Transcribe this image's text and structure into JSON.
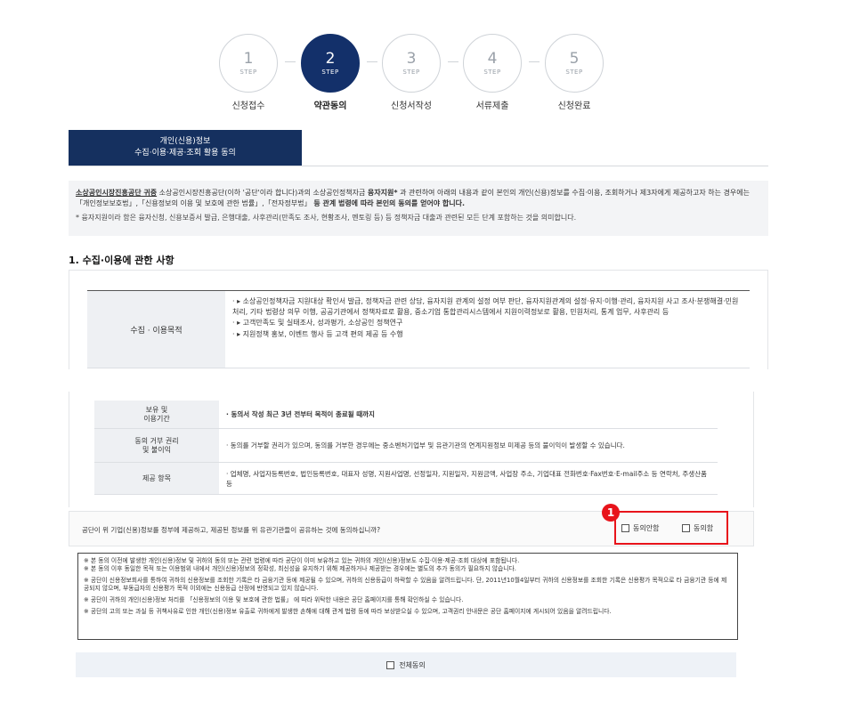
{
  "steps": [
    {
      "num": "1",
      "label": "STEP",
      "name": "신청접수"
    },
    {
      "num": "2",
      "label": "STEP",
      "name": "약관동의"
    },
    {
      "num": "3",
      "label": "STEP",
      "name": "신청서작성"
    },
    {
      "num": "4",
      "label": "STEP",
      "name": "서류제출"
    },
    {
      "num": "5",
      "label": "STEP",
      "name": "신청완료"
    }
  ],
  "tab": {
    "line1": "개인(신용)정보",
    "line2": "수집·이용·제공·조회 활용 동의"
  },
  "intro": {
    "org": "소상공인시장진흥공단 귀중",
    "text1": " 소상공인시장진흥공단(이하 '공단'이라 합니다)과의 소상공인정책자금 ",
    "keyword": "융자지원*",
    "text2": " 과 관련하여 아래의 내용과 같이 본인의 개인(신용)정보를 수집·이용, 조회하거나 제3자에게 제공하고자 하는 경우에는「개인정보보호법」,「신용정보의 이용 및 보호에 관한 법률」,「전자정부법」",
    "bold_end": " 등 관계 법령에 따라 본인의 동의를 얻어야 합니다.",
    "note": "* 융자지원이라 함은 융자신청, 신용보증서 발급, 은행대출, 사후관리(만족도 조사, 현황조사, 멘토링 등) 등 정책자금 대출과 관련된 모든 단계 포함하는 것을 의미합니다."
  },
  "section_title": "1. 수집·이용에 관한 사항",
  "table1": {
    "header": "수집 · 이용목적",
    "items": [
      "· ▸ 소상공인정책자금 지원대상 확인서 발급, 정책자금 관련 상담, 융자지원 관계의 설정 여부 판단, 융자지원관계의 설정·유지·이행·관리, 융자지원 사고 조사·분쟁해결·민원처리, 기타 법령상 의무 이행, 공공기관에서 정책자료로 활용, 중소기업 통합관리시스템에서 지원이력정보로 활용, 민원처리, 통계 업무, 사후관리 등",
      "· ▸ 고객만족도 및 실태조사, 성과평가, 소상공인 정책연구",
      "· ▸ 지원정책 홍보, 이벤트 행사 등 고객 편의 제공 등 수행"
    ]
  },
  "table2": [
    {
      "header": "보유 및\n이용기간",
      "value": "· 동의서 작성 최근 3년 전부터 목적이 종료될 때까지"
    },
    {
      "header": "동의 거부 권리\n및 불이익",
      "value": "· 동의를 거부할 권리가 있으며, 동의를 거부한 경우에는 중소벤처기업부 및 유관기관의 연계지원정보 미제공 등의 불이익이 발생할 수 있습니다."
    },
    {
      "header": "제공 항목",
      "value": "· 업체명, 사업자등록번호, 법인등록번호, 대표자 성명, 지원사업명, 선정일자, 지원일자, 지원금액, 사업장 주소, 기업대표 전화번호·Fax번호·E-mail주소 등 연락처, 주생산품 등"
    }
  ],
  "consent": {
    "question": "공단이 위 기업(신용)정보를 정부에 제공하고, 제공된 정보를 위 유관기관들이 공유하는 것에 동의하십니까?",
    "disagree": "동의안함",
    "agree": "동의함"
  },
  "badge": "1",
  "notices": [
    "※ 본 동의 이전에 발생한 개인(신용)정보 및 귀하의 동의 또는 관련 법령에 따라 공단이 이미 보유하고 있는 귀하의 개인(신용)정보도 수집·이용·제공·조회 대상에 포함됩니다.\n※ 본 동의 이후 동일한 목적 또는 이용범위 내에서 개인(신용)정보의 정확성, 최신성을 유지하기 위해 제공하거나 제공받는 경우에는 별도의 추가 동의가 필요하지 않습니다.",
    "※ 공단이 신용정보회사를 통하여 귀하의 신용정보를 조회한 기록은 타 금융기관 등에 제공될 수 있으며, 귀하의 신용등급이 하락할 수 있음을 알려드립니다. 단, 2011년10월4일부터 귀하의 신용정보를 조회한 기록은 신용평가 목적으로 타 금융기관 등에 제공되지 않으며, 부동급자의 신용평가 목적 이외에는 신용등급 산정에 반영되고 있지 않습니다.",
    "※ 공단이 귀하의 개인(신용)정보 처리를 「신용정보의 이용 및 보호에 관한 법률」 에 따라 위탁한 내용은 공단 홈페이지를 통해 확인하실 수 있습니다.",
    "※ 공단의 고의 또는 과실 등 귀책사유로 인한 개인(신용)정보 유출로 귀하에게 발생한 손해에 대해 관계 법령 등에 따라 보상받으실 수 있으며, 고객권리 안내문은 공단 홈페이지에 게시되어 있음을 알려드립니다."
  ],
  "select_all": "전체동의"
}
